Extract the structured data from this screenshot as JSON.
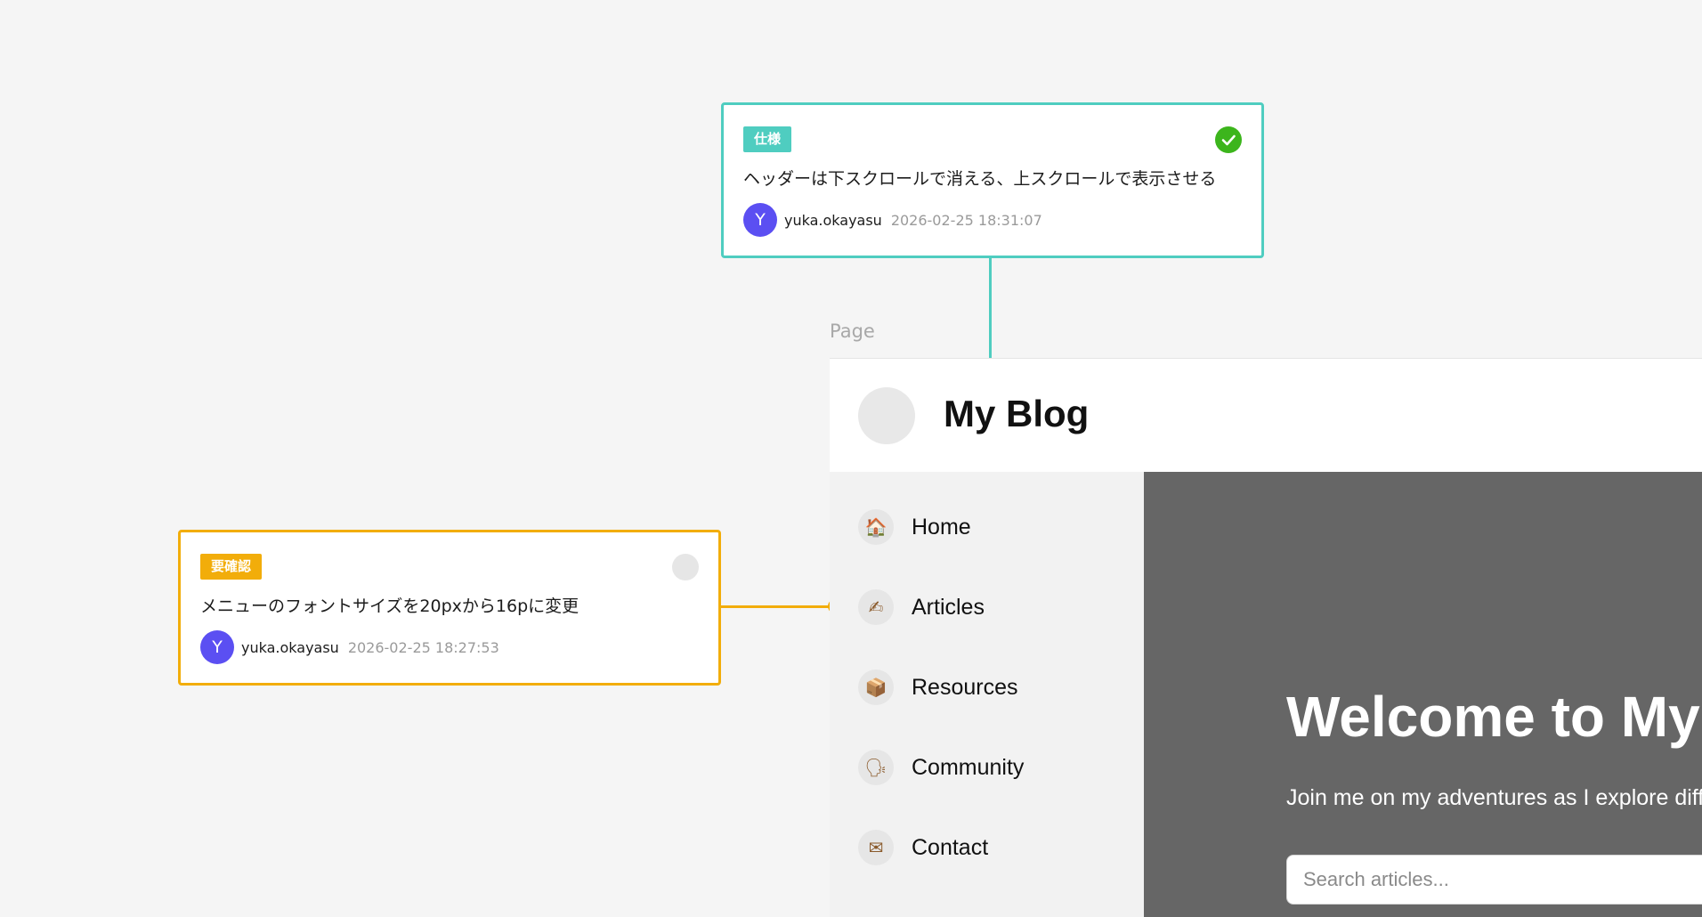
{
  "comments": [
    {
      "tag": "仕様",
      "status": "resolved",
      "text": "ヘッダーは下スクロールで消える、上スクロールで表示させる",
      "author_initial": "Y",
      "author": "yuka.okayasu",
      "timestamp": "2026-02-25 18:31:07"
    },
    {
      "tag": "要確認",
      "status": "open",
      "text": "メニューのフォントサイズを20pxから16pに変更",
      "author_initial": "Y",
      "author": "yuka.okayasu",
      "timestamp": "2026-02-25 18:27:53"
    }
  ],
  "frame": {
    "label": "Page"
  },
  "page": {
    "site_title": "My Blog",
    "nav": [
      {
        "icon": "house-icon",
        "glyph": "🏠",
        "label": "Home"
      },
      {
        "icon": "writing-hand-icon",
        "glyph": "✍",
        "label": "Articles"
      },
      {
        "icon": "package-icon",
        "glyph": "📦",
        "label": "Resources"
      },
      {
        "icon": "speaking-head-icon",
        "glyph": "🗣",
        "label": "Community"
      },
      {
        "icon": "envelope-icon",
        "glyph": "✉",
        "label": "Contact"
      }
    ],
    "hero": {
      "title": "Welcome to My Blog",
      "subtitle": "Join me on my adventures as I explore different topics",
      "search_placeholder": "Search articles..."
    }
  },
  "colors": {
    "spec_tag": "#4fcdc0",
    "confirm_tag": "#f2ad0a",
    "resolved_check": "#3cb51c",
    "avatar": "#5b4ff2",
    "hero_bg": "#666666",
    "sidebar_bg": "#f2f2f2"
  }
}
